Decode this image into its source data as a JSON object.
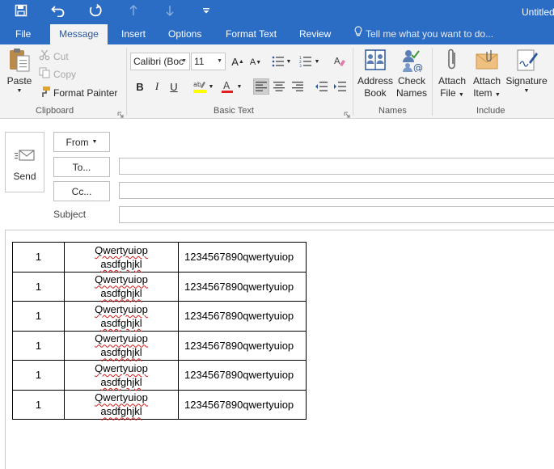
{
  "window": {
    "title": "Untitled"
  },
  "quick_access": [
    {
      "name": "save-icon"
    },
    {
      "name": "undo-icon"
    },
    {
      "name": "redo-icon"
    },
    {
      "name": "up-arrow-icon"
    },
    {
      "name": "down-arrow-icon"
    },
    {
      "name": "customize-qat-icon"
    }
  ],
  "tabs": {
    "file": "File",
    "message": "Message",
    "insert": "Insert",
    "options": "Options",
    "format_text": "Format Text",
    "review": "Review"
  },
  "tell_me": "Tell me what you want to do...",
  "clipboard": {
    "paste": "Paste",
    "cut": "Cut",
    "copy": "Copy",
    "format_painter": "Format Painter",
    "group_label": "Clipboard"
  },
  "basic_text": {
    "font_name": "Calibri (Boc",
    "font_size": "11",
    "bold": "B",
    "italic": "I",
    "underline": "U",
    "group_label": "Basic Text"
  },
  "names": {
    "address_book_1": "Address",
    "address_book_2": "Book",
    "check_names_1": "Check",
    "check_names_2": "Names",
    "group_label": "Names"
  },
  "include": {
    "attach_file_1": "Attach",
    "attach_file_2": "File",
    "attach_item_1": "Attach",
    "attach_item_2": "Item",
    "signature": "Signature",
    "group_label": "Include"
  },
  "compose": {
    "send": "Send",
    "from": "From",
    "to": "To...",
    "cc": "Cc...",
    "subject": "Subject",
    "to_value": "",
    "cc_value": "",
    "subject_value": ""
  },
  "table": {
    "rows": [
      {
        "c1": "1",
        "c2a": "Qwertyuiop",
        "c2b": "asdfghjkl",
        "c3": "1234567890qwertyuiop"
      },
      {
        "c1": "1",
        "c2a": "Qwertyuiop",
        "c2b": "asdfghjkl",
        "c3": "1234567890qwertyuiop"
      },
      {
        "c1": "1",
        "c2a": "Qwertyuiop",
        "c2b": "asdfghjkl",
        "c3": "1234567890qwertyuiop"
      },
      {
        "c1": "1",
        "c2a": "Qwertyuiop",
        "c2b": "asdfghjkl",
        "c3": "1234567890qwertyuiop"
      },
      {
        "c1": "1",
        "c2a": "Qwertyuiop",
        "c2b": "asdfghjkl",
        "c3": "1234567890qwertyuiop"
      },
      {
        "c1": "1",
        "c2a": "Qwertyuiop",
        "c2b": "asdfghjkl",
        "c3": "1234567890qwertyuiop"
      }
    ]
  },
  "colors": {
    "titlebar": "#2b6cc4",
    "ribbon": "#f3f3f3",
    "active_tab_text": "#2b579a",
    "highlight": "#ffff00",
    "font_color": "#e02020"
  }
}
